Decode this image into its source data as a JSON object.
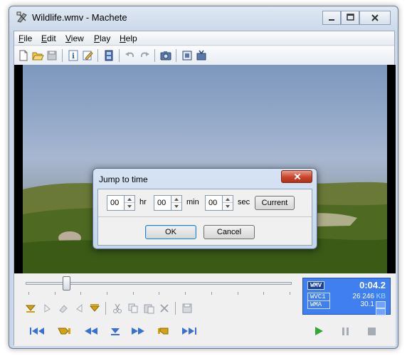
{
  "window": {
    "title": "Wildlife.wmv - Machete"
  },
  "titlebar": {
    "minimize_icon": "minimize-icon",
    "maximize_icon": "maximize-icon",
    "close_icon": "close-icon"
  },
  "menu": [
    {
      "label": "File",
      "underline": "F",
      "rest": "ile"
    },
    {
      "label": "Edit",
      "underline": "E",
      "rest": "dit"
    },
    {
      "label": "View",
      "underline": "V",
      "rest": "iew"
    },
    {
      "label": "Play",
      "underline": "P",
      "rest": "lay"
    },
    {
      "label": "Help",
      "underline": "H",
      "rest": "elp"
    }
  ],
  "toolbar": {
    "icons": [
      "new-file-icon",
      "open-folder-icon",
      "save-icon",
      "info-icon",
      "edit-tags-icon",
      "filmstrip-icon",
      "undo-icon",
      "redo-icon",
      "snapshot-camera-icon",
      "frame-select-icon",
      "frame-export-icon"
    ]
  },
  "dialog": {
    "title": "Jump to time",
    "hr": {
      "value": "00",
      "unit": "hr"
    },
    "min": {
      "value": "00",
      "unit": "min"
    },
    "sec": {
      "value": "00",
      "unit": "sec"
    },
    "current_label": "Current",
    "ok_label": "OK",
    "cancel_label": "Cancel"
  },
  "seek": {
    "position": 0.14
  },
  "info_panel": {
    "format": "WMV",
    "time": "0:04.2",
    "video_codec": "WVC1",
    "audio_codec": "WMA",
    "bitrate": "26 246",
    "bitrate_unit": "KB",
    "fps": "30.1"
  },
  "edit_toolbar": {
    "icons": [
      "mark-in-icon",
      "select-start-icon",
      "eraser-icon",
      "select-end-icon",
      "mark-out-icon",
      "cut-icon",
      "copy-icon",
      "paste-icon",
      "delete-icon",
      "save-selection-icon"
    ]
  },
  "transport": {
    "icons": [
      "go-to-start-icon",
      "go-to-mark-in-icon",
      "step-back-icon",
      "go-to-position-icon",
      "step-forward-icon",
      "go-to-mark-out-icon",
      "go-to-end-icon",
      "play-icon",
      "pause-icon",
      "stop-icon"
    ]
  },
  "colors": {
    "accent_gold": "#d4a20e",
    "transport_blue": "#3a6fd8",
    "play_green": "#2fa838",
    "info_panel_bg": "#3f7ff0"
  }
}
